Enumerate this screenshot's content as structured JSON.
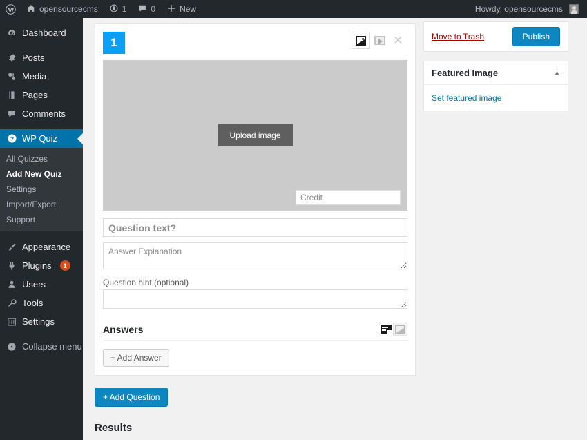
{
  "adminbar": {
    "logo_icon": "wordpress-logo-icon",
    "site_name": "opensourcecms",
    "site_icon": "home-icon",
    "updates_icon": "updates-icon",
    "updates_count": "1",
    "comments_icon": "comment-bubble-icon",
    "comments_count": "0",
    "new_icon": "plus-icon",
    "new_label": "New",
    "howdy": "Howdy, opensourcecms",
    "avatar_icon": "user-avatar-icon"
  },
  "sidebar": {
    "items": [
      {
        "label": "Dashboard",
        "icon": "dashboard-icon"
      },
      {
        "label": "Posts",
        "icon": "pin-icon"
      },
      {
        "label": "Media",
        "icon": "media-icon"
      },
      {
        "label": "Pages",
        "icon": "page-icon"
      },
      {
        "label": "Comments",
        "icon": "comment-icon"
      },
      {
        "label": "WP Quiz",
        "icon": "question-mark-icon"
      },
      {
        "label": "Appearance",
        "icon": "paintbrush-icon"
      },
      {
        "label": "Plugins",
        "icon": "plug-icon",
        "badge": "1"
      },
      {
        "label": "Users",
        "icon": "users-icon"
      },
      {
        "label": "Tools",
        "icon": "wrench-icon"
      },
      {
        "label": "Settings",
        "icon": "settings-sliders-icon"
      },
      {
        "label": "Collapse menu",
        "icon": "collapse-arrow-icon"
      }
    ],
    "submenu": [
      {
        "label": "All Quizzes"
      },
      {
        "label": "Add New Quiz"
      },
      {
        "label": "Settings"
      },
      {
        "label": "Import/Export"
      },
      {
        "label": "Support"
      }
    ]
  },
  "question": {
    "number": "1",
    "tools": {
      "image_icon": "image-icon",
      "video_icon": "video-icon",
      "close_icon": "close-icon"
    },
    "upload_label": "Upload image",
    "credit_placeholder": "Credit",
    "question_placeholder": "Question text?",
    "explanation_placeholder": "Answer Explanation",
    "hint_label": "Question hint (optional)",
    "hint_value": ""
  },
  "answers": {
    "title": "Answers",
    "text_icon": "text-answers-icon",
    "image_icon": "image-answers-icon",
    "add_label": "+ Add Answer"
  },
  "footer": {
    "add_question_label": "+ Add Question",
    "results_title": "Results"
  },
  "publish": {
    "trash_label": "Move to Trash",
    "publish_label": "Publish"
  },
  "featured_image": {
    "title": "Featured Image",
    "toggle_icon": "chevron-up-icon",
    "set_label": "Set featured image"
  },
  "colors": {
    "accent_blue": "#0073aa",
    "button_blue": "#0e86c0",
    "number_badge_blue": "#0d9ef5",
    "admin_dark": "#23282d",
    "submenu_dark": "#32373c",
    "badge_orange": "#d54e21",
    "trash_red": "#a00"
  }
}
